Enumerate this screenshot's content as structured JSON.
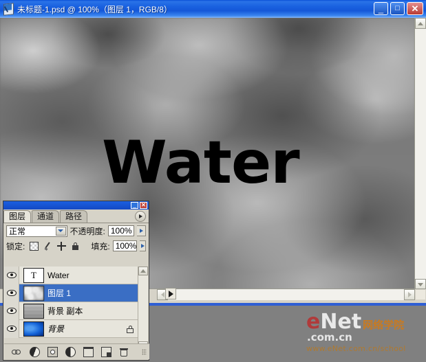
{
  "window": {
    "title": "未标题-1.psd @ 100%（图层 1，RGB/8）",
    "icon": "photoshop-document-icon",
    "minimize_label": "_",
    "maximize_label": "□",
    "close_label": "✕"
  },
  "canvas": {
    "text_layer_content": "Water"
  },
  "palette": {
    "minimize_label": "_",
    "close_label": "✕",
    "tabs": [
      {
        "label": "图层",
        "active": true
      },
      {
        "label": "通道",
        "active": false
      },
      {
        "label": "路径",
        "active": false
      }
    ],
    "menu_icon": "palette-menu-icon",
    "blend_mode": "正常",
    "opacity_label": "不透明度:",
    "opacity_value": "100%",
    "lock_label": "锁定:",
    "lock_icons": [
      "lock-transparency-icon",
      "lock-image-icon",
      "lock-position-icon",
      "lock-all-icon"
    ],
    "fill_label": "填充:",
    "fill_value": "100%",
    "layers": [
      {
        "name": "Water",
        "thumb": "text-T",
        "visible": true,
        "selected": false,
        "locked": false,
        "italic": false
      },
      {
        "name": "图层 1",
        "thumb": "clouds",
        "visible": true,
        "selected": true,
        "locked": false,
        "italic": false
      },
      {
        "name": "背景 副本",
        "thumb": "noise",
        "visible": true,
        "selected": false,
        "locked": false,
        "italic": false
      },
      {
        "name": "背景",
        "thumb": "blue-gradient",
        "visible": true,
        "selected": false,
        "locked": true,
        "italic": true
      }
    ],
    "footer_icons": [
      "link-layers-icon",
      "layer-style-fx-icon",
      "add-layer-mask-icon",
      "new-adjustment-layer-icon",
      "new-group-folder-icon",
      "new-layer-icon",
      "delete-layer-trash-icon"
    ]
  },
  "watermark": {
    "e": "e",
    "net": "Net",
    "cn_words": "网络学院",
    "com": ".com.cn",
    "url": "www.eNet.com.cn/school"
  },
  "colors": {
    "titlebar_blue": "#1a62e0",
    "selection_blue": "#3a6ec4",
    "palette_bg": "#d6d3c8",
    "desktop_gray": "#808080",
    "close_red": "#b83b34"
  }
}
